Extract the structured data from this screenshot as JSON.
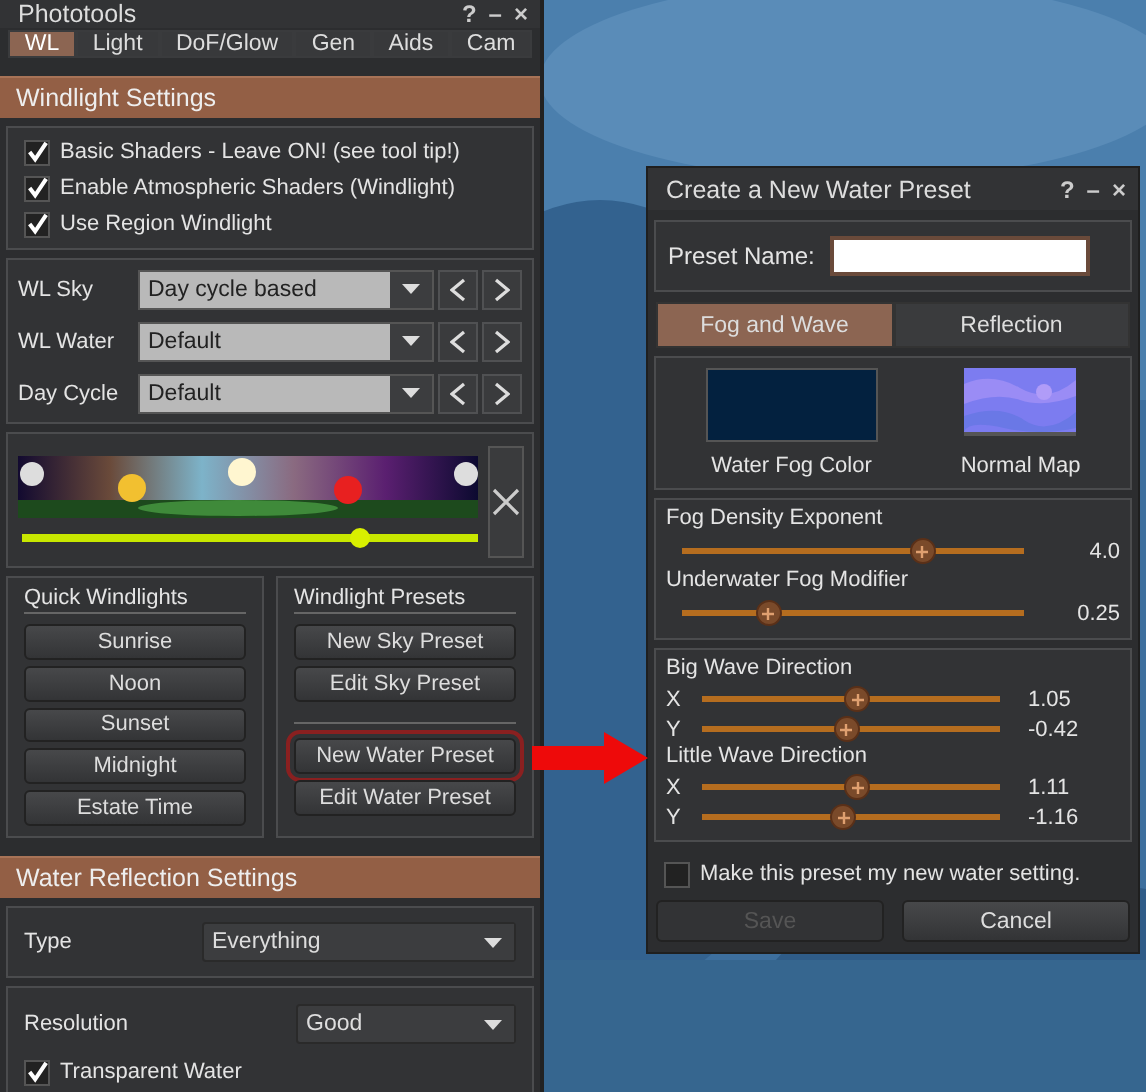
{
  "phototools": {
    "title": "Phototools",
    "title_buttons": [
      "?",
      "–",
      "×"
    ],
    "tabs": [
      {
        "label": "WL",
        "selected": true
      },
      {
        "label": "Light",
        "selected": false
      },
      {
        "label": "DoF/Glow",
        "selected": false
      },
      {
        "label": "Gen",
        "selected": false
      },
      {
        "label": "Aids",
        "selected": false
      },
      {
        "label": "Cam",
        "selected": false
      }
    ],
    "windlight": {
      "header": "Windlight Settings",
      "checkboxes": [
        {
          "label": "Basic Shaders - Leave ON! (see tool tip!)",
          "checked": true
        },
        {
          "label": "Enable Atmospheric Shaders (Windlight)",
          "checked": true
        },
        {
          "label": "Use Region Windlight",
          "checked": true
        }
      ],
      "selectors": [
        {
          "label": "WL Sky",
          "value": "Day cycle based"
        },
        {
          "label": "WL Water",
          "value": "Default"
        },
        {
          "label": "Day Cycle",
          "value": "Default"
        }
      ],
      "time_slider": {
        "level": 0.74
      },
      "quick": {
        "title": "Quick Windlights",
        "buttons": [
          "Sunrise",
          "Noon",
          "Sunset",
          "Midnight",
          "Estate Time"
        ]
      },
      "presets": {
        "title": "Windlight Presets",
        "groups": [
          [
            {
              "label": "New Sky Preset",
              "highlighted": false
            },
            {
              "label": "Edit Sky Preset",
              "highlighted": false
            }
          ],
          [
            {
              "label": "New Water Preset",
              "highlighted": true
            },
            {
              "label": "Edit Water Preset",
              "highlighted": false
            }
          ]
        ]
      }
    },
    "water_reflection": {
      "header": "Water Reflection Settings",
      "type": {
        "label": "Type",
        "value": "Everything"
      },
      "resolution": {
        "label": "Resolution",
        "value": "Good"
      },
      "transparent": {
        "label": "Transparent Water",
        "checked": true
      }
    }
  },
  "water_preset": {
    "title": "Create a New Water Preset",
    "title_buttons": [
      "?",
      "–",
      "×"
    ],
    "name_label": "Preset Name:",
    "tabs": [
      {
        "label": "Fog and Wave",
        "selected": true
      },
      {
        "label": "Reflection",
        "selected": false
      }
    ],
    "swatches": [
      {
        "kind": "color",
        "label": "Water Fog Color",
        "color": "#03213f"
      },
      {
        "kind": "texture",
        "label": "Normal Map"
      }
    ],
    "fog": [
      {
        "label": "Fog Density Exponent",
        "level": 0.7,
        "reading": "4.0"
      },
      {
        "label": "Underwater Fog Modifier",
        "level": 0.25,
        "reading": "0.25"
      }
    ],
    "waves": [
      {
        "title": "Big Wave Direction",
        "axes": [
          {
            "label": "X",
            "level": 0.52,
            "reading": "1.05"
          },
          {
            "label": "Y",
            "level": 0.48,
            "reading": "-0.42"
          }
        ]
      },
      {
        "title": "Little Wave Direction",
        "axes": [
          {
            "label": "X",
            "level": 0.52,
            "reading": "1.11"
          },
          {
            "label": "Y",
            "level": 0.47,
            "reading": "-1.16"
          }
        ]
      }
    ],
    "default_check": {
      "label": "Make this preset my new water setting.",
      "checked": false
    },
    "buttons": [
      {
        "label": "Save",
        "disabled": true
      },
      {
        "label": "Cancel",
        "disabled": false
      }
    ]
  }
}
